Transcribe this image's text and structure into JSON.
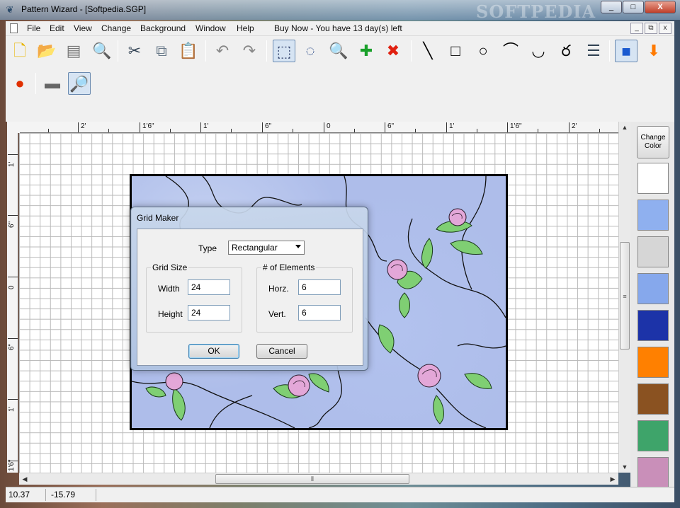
{
  "window": {
    "title": "Pattern Wizard - [Softpedia.SGP]",
    "watermark": "SOFTPEDIA"
  },
  "window_controls": {
    "minimize": "_",
    "maximize": "□",
    "close": "X"
  },
  "menu": {
    "items": [
      "File",
      "Edit",
      "View",
      "Change",
      "Background",
      "Window",
      "Help",
      "Buy Now - You have 13 day(s) left"
    ],
    "mdi": {
      "minimize": "_",
      "restore": "⧉",
      "close": "x"
    }
  },
  "toolbar": {
    "row1": [
      {
        "name": "new-icon",
        "glyph": "🗋"
      },
      {
        "name": "open-folder-icon",
        "glyph": "📂"
      },
      {
        "name": "scanner-icon",
        "glyph": "▤"
      },
      {
        "name": "print-preview-icon",
        "glyph": "🔍"
      },
      {
        "name": "cut-icon",
        "glyph": "✂"
      },
      {
        "name": "copy-icon",
        "glyph": "⧉"
      },
      {
        "name": "paste-icon",
        "glyph": "📋"
      },
      {
        "name": "undo-icon",
        "glyph": "↶"
      },
      {
        "name": "redo-icon",
        "glyph": "↷"
      },
      {
        "name": "rect-select-icon",
        "glyph": "⬚"
      },
      {
        "name": "lasso-icon",
        "glyph": "◌"
      },
      {
        "name": "zoom-icon",
        "glyph": "🔍"
      },
      {
        "name": "add-icon",
        "glyph": "✚"
      },
      {
        "name": "delete-icon",
        "glyph": "✖"
      },
      {
        "name": "line-tool-icon",
        "glyph": "╲"
      },
      {
        "name": "rectangle-tool-icon",
        "glyph": "□"
      },
      {
        "name": "circle-tool-icon",
        "glyph": "○"
      },
      {
        "name": "arc-tool-icon",
        "glyph": "⌒"
      },
      {
        "name": "curve-tool-icon",
        "glyph": "◡"
      },
      {
        "name": "freehand-tool-icon",
        "glyph": "ర"
      },
      {
        "name": "text-tool-icon",
        "glyph": "☰"
      },
      {
        "name": "fill-color-icon",
        "glyph": "■"
      },
      {
        "name": "download-icon",
        "glyph": "⬇"
      }
    ],
    "row2": [
      {
        "name": "record-icon",
        "glyph": "●"
      },
      {
        "name": "dark-panel-icon",
        "glyph": "▬"
      },
      {
        "name": "zoom-grid-icon",
        "glyph": "🔎"
      }
    ]
  },
  "ruler": {
    "h_labels": [
      "2'",
      "1'6\"",
      "1'",
      "6\"",
      "0",
      "6\"",
      "1'",
      "1'6\"",
      "2'"
    ],
    "v_labels": [
      "1'",
      "6\"",
      "0",
      "6\"",
      "1'",
      "1'6\""
    ]
  },
  "palette": {
    "change_color_label": "Change Color",
    "swatches": [
      "#ffffff",
      "#8fb0ef",
      "#d6d6d6",
      "#86a8ec",
      "#1c33a8",
      "#ff8000",
      "#8a5221",
      "#3ea46a",
      "#c98fb9"
    ]
  },
  "status": {
    "x": "10.37",
    "y": "-15.79"
  },
  "dialog": {
    "title": "Grid Maker",
    "type_label": "Type",
    "type_value": "Rectangular",
    "grid_size": {
      "legend": "Grid Size",
      "width_label": "Width",
      "width_value": "24",
      "height_label": "Height",
      "height_value": "24"
    },
    "elements": {
      "legend": "# of Elements",
      "horz_label": "Horz.",
      "horz_value": "6",
      "vert_label": "Vert.",
      "vert_value": "6"
    },
    "ok_label": "OK",
    "cancel_label": "Cancel"
  }
}
